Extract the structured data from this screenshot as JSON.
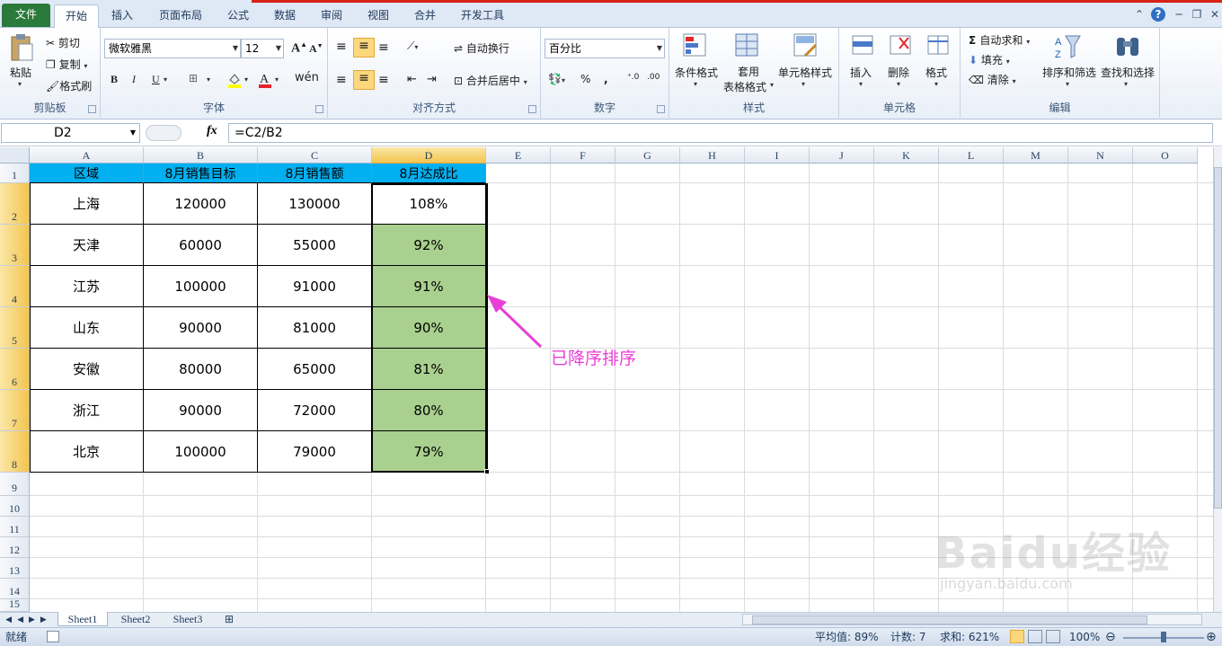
{
  "ribbon_tabs": [
    "文件",
    "开始",
    "插入",
    "页面布局",
    "公式",
    "数据",
    "审阅",
    "视图",
    "合并",
    "开发工具"
  ],
  "clipboard": {
    "paste": "粘贴",
    "cut": "剪切",
    "copy": "复制",
    "format_painter": "格式刷",
    "label": "剪贴板"
  },
  "font": {
    "name": "微软雅黑",
    "size": "12",
    "bold": "B",
    "italic": "I",
    "underline": "U",
    "label": "字体"
  },
  "alignment": {
    "wrap": "自动换行",
    "merge": "合并后居中",
    "label": "对齐方式"
  },
  "number": {
    "format": "百分比",
    "percent": "%",
    "comma": ",",
    "label": "数字"
  },
  "styles": {
    "conditional": "条件格式",
    "table": "套用",
    "table2": "表格格式",
    "cell_styles": "单元格样式",
    "label": "样式"
  },
  "cells": {
    "insert": "插入",
    "delete": "删除",
    "format": "格式",
    "label": "单元格"
  },
  "editing": {
    "autosum": "自动求和",
    "fill": "填充",
    "clear": "清除",
    "sort": "排序和筛选",
    "find": "查找和选择",
    "label": "编辑"
  },
  "formula_bar": {
    "name_box": "D2",
    "fx": "fx",
    "formula": "=C2/B2"
  },
  "columns": [
    "A",
    "B",
    "C",
    "D",
    "E",
    "F",
    "G",
    "H",
    "I",
    "J",
    "K",
    "L",
    "M",
    "N",
    "O"
  ],
  "rows": [
    "1",
    "2",
    "3",
    "4",
    "5",
    "6",
    "7",
    "8",
    "9",
    "10",
    "11",
    "12",
    "13",
    "14",
    "15"
  ],
  "table": {
    "headers": [
      "区域",
      "8月销售目标",
      "8月销售额",
      "8月达成比"
    ],
    "rows": [
      [
        "上海",
        "120000",
        "130000",
        "108%"
      ],
      [
        "天津",
        "60000",
        "55000",
        "92%"
      ],
      [
        "江苏",
        "100000",
        "91000",
        "91%"
      ],
      [
        "山东",
        "90000",
        "81000",
        "90%"
      ],
      [
        "安徽",
        "80000",
        "65000",
        "81%"
      ],
      [
        "浙江",
        "90000",
        "72000",
        "80%"
      ],
      [
        "北京",
        "100000",
        "79000",
        "79%"
      ]
    ]
  },
  "annotation": "已降序排序",
  "sheets": [
    "Sheet1",
    "Sheet2",
    "Sheet3"
  ],
  "status": {
    "ready": "就绪",
    "average": "平均值: 89%",
    "count": "计数: 7",
    "sum": "求和: 621%",
    "zoom": "100%"
  },
  "watermark": {
    "main": "Baidu经验",
    "sub": "jingyan.baidu.com"
  },
  "colors": {
    "header_fill": "#00b0f0",
    "highlight_fill": "#a9d08e",
    "annotation": "#e93fd6",
    "file_tab": "#2a7a3b"
  }
}
